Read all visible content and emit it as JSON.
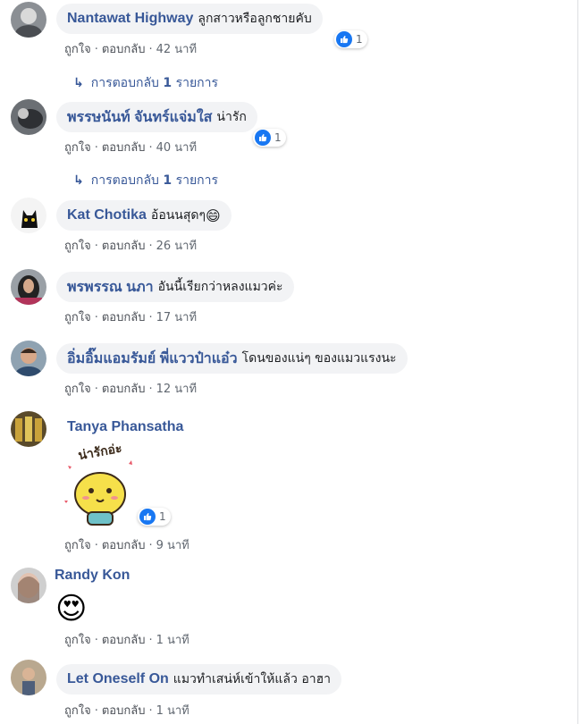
{
  "comments": [
    {
      "name": "Nantawat Highway",
      "text": "ลูกสาวหรือลูกชายคับ",
      "like": "ถูกใจ",
      "reply": "ตอบกลับ",
      "time": "42 นาที",
      "reactions": "1",
      "replies_label": "การตอบกลับ",
      "replies_count": "1",
      "replies_unit": "รายการ"
    },
    {
      "name": "พรรษนันท์ จันทร์แจ่มใส",
      "text": "น่ารัก",
      "like": "ถูกใจ",
      "reply": "ตอบกลับ",
      "time": "40 นาที",
      "reactions": "1",
      "replies_label": "การตอบกลับ",
      "replies_count": "1",
      "replies_unit": "รายการ"
    },
    {
      "name": "Kat Chotika",
      "text": "อ้อนนสุดๆ",
      "emoji": "😄",
      "like": "ถูกใจ",
      "reply": "ตอบกลับ",
      "time": "26 นาที"
    },
    {
      "name": "พรพรรณ นภา",
      "text": "อันนี้เรียกว่าหลงแมวค่ะ",
      "like": "ถูกใจ",
      "reply": "ตอบกลับ",
      "time": "17 นาที"
    },
    {
      "name": "อิ่มอิ๊มแอมรัมย์ พี่แววป๋าแอ๋ว",
      "text": "โดนของแน่ๆ ของแมวแรงนะ",
      "like": "ถูกใจ",
      "reply": "ตอบกลับ",
      "time": "12 นาที"
    },
    {
      "name": "Tanya Phansatha",
      "sticker_text": "น่ารักอ่ะ",
      "like": "ถูกใจ",
      "reply": "ตอบกลับ",
      "time": "9 นาที",
      "reactions": "1"
    },
    {
      "name": "Randy Kon",
      "emoji": "😍",
      "like": "ถูกใจ",
      "reply": "ตอบกลับ",
      "time": "1 นาที"
    },
    {
      "name": "Let Oneself On",
      "text": "แมวทำเสน่ห์เข้าให้แล้ว อาฮา",
      "like": "ถูกใจ",
      "reply": "ตอบกลับ",
      "time": "1 นาที"
    }
  ],
  "icons": {
    "like": "thumbs-up-icon",
    "reply_arrow": "reply-arrow-icon"
  },
  "colors": {
    "name": "#385898",
    "bubble": "#f2f3f5",
    "like_badge": "#1877f2",
    "meta": "#606770"
  }
}
